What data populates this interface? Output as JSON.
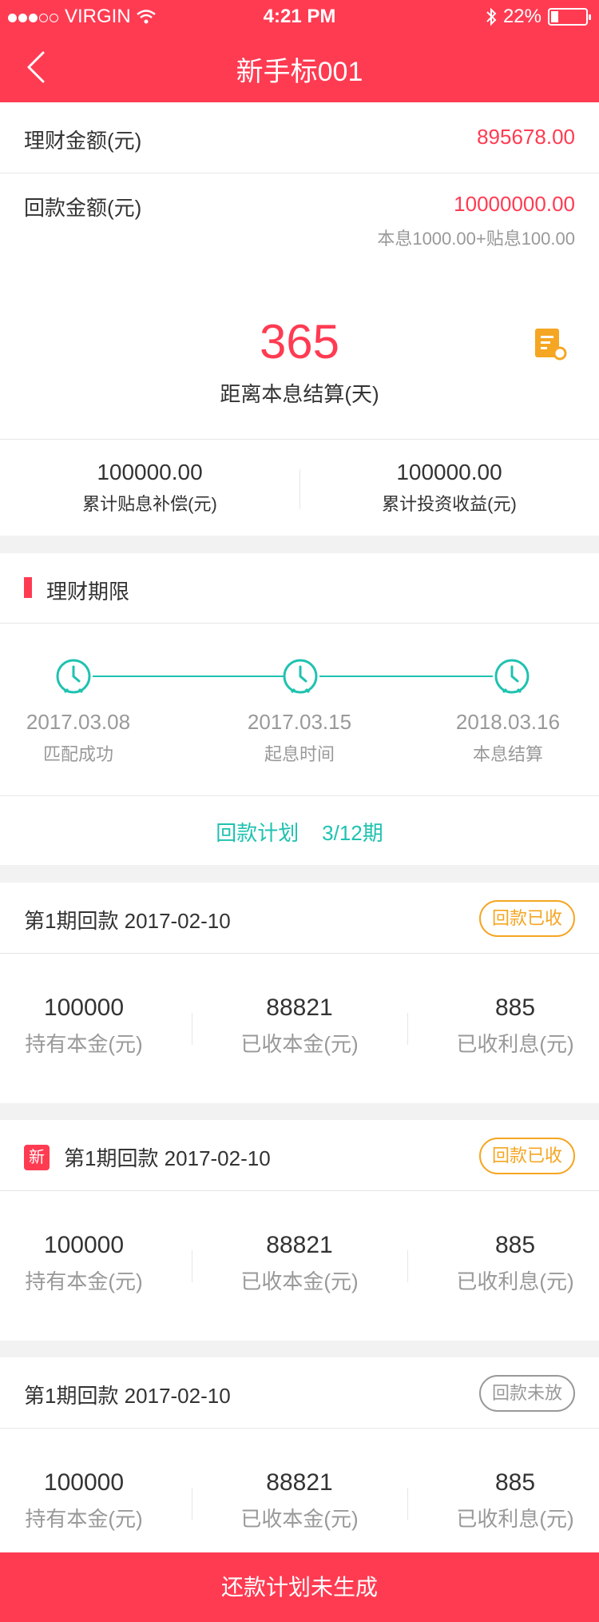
{
  "status_bar": {
    "carrier": "VIRGIN",
    "time": "4:21 PM",
    "battery": "22%"
  },
  "nav": {
    "title": "新手标001"
  },
  "summary": {
    "invest_label": "理财金额(元)",
    "invest_value": "895678.00",
    "return_label": "回款金额(元)",
    "return_value": "10000000.00",
    "return_detail": "本息1000.00+贴息100.00"
  },
  "countdown": {
    "days": "365",
    "label": "距离本息结算(天)",
    "stat_left_value": "100000.00",
    "stat_left_label": "累计贴息补偿(元)",
    "stat_right_value": "100000.00",
    "stat_right_label": "累计投资收益(元)"
  },
  "term": {
    "title": "理财期限",
    "steps": [
      {
        "date": "2017.03.08",
        "label": "匹配成功"
      },
      {
        "date": "2017.03.15",
        "label": "起息时间"
      },
      {
        "date": "2018.03.16",
        "label": "本息结算"
      }
    ],
    "plan_label": "回款计划",
    "plan_progress": "3/12期"
  },
  "cards": [
    {
      "title": "第1期回款 2017-02-10",
      "new": false,
      "status": "回款已收",
      "cols": [
        {
          "value": "100000",
          "label": "持有本金(元)"
        },
        {
          "value": "88821",
          "label": "已收本金(元)"
        },
        {
          "value": "885",
          "label": "已收利息(元)"
        }
      ]
    },
    {
      "title": "第1期回款 2017-02-10",
      "new": true,
      "new_tag": "新",
      "status": "回款已收",
      "cols": [
        {
          "value": "100000",
          "label": "持有本金(元)"
        },
        {
          "value": "88821",
          "label": "已收本金(元)"
        },
        {
          "value": "885",
          "label": "已收利息(元)"
        }
      ]
    },
    {
      "title": "第1期回款 2017-02-10",
      "new": false,
      "status": "回款未放",
      "cols": [
        {
          "value": "100000",
          "label": "持有本金(元)"
        },
        {
          "value": "88821",
          "label": "已收本金(元)"
        },
        {
          "value": "885",
          "label": "已收利息(元)"
        }
      ]
    }
  ],
  "footer": {
    "label": "还款计划未生成"
  },
  "colors": {
    "brand_red": "#ff3b52",
    "teal": "#1fc2b0",
    "orange": "#f5a623"
  }
}
